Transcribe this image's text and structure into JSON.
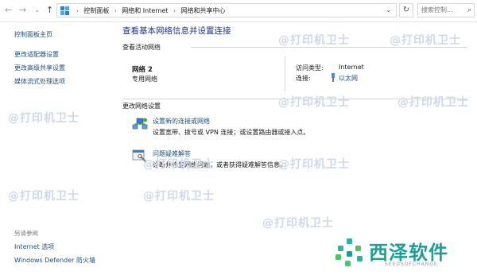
{
  "toolbar": {
    "back": "←",
    "forward": "→",
    "recent": "⌄",
    "up": "↑",
    "breadcrumbs": [
      "控制面板",
      "网络和 Internet",
      "网络和共享中心"
    ],
    "search_placeholder": "搜索控制..."
  },
  "sidebar": {
    "home": "控制面板主页",
    "links": [
      "更改适配器设置",
      "更改高级共享设置",
      "媒体流式处理选项"
    ],
    "see_also_title": "另请参阅",
    "see_also": [
      "Internet 选项",
      "Windows Defender 防火墙"
    ]
  },
  "main": {
    "title": "查看基本网络信息并设置连接",
    "active_networks_header": "查看活动网络",
    "network": {
      "name": "网络 2",
      "type": "专用网络",
      "access_type_label": "访问类型:",
      "access_type_value": "Internet",
      "connection_label": "连接:",
      "connection_value": "以太网"
    },
    "change_settings_header": "更改网络设置",
    "tasks": [
      {
        "link": "设置新的连接或网络",
        "desc": "设置宽带、拨号或 VPN 连接；或设置路由器或接入点。",
        "icon": "network-setup-icon"
      },
      {
        "link": "问题疑难解答",
        "desc": "诊断并修复网络问题，或者获得疑难解答信息。",
        "icon": "troubleshoot-icon"
      }
    ]
  },
  "watermarks": [
    "@打印机卫士",
    "@打印机卫士",
    "@打印机卫士",
    "@打印机卫士",
    "@打印机卫士",
    "@打印机卫士",
    "@打印机卫士",
    "@打印机卫士",
    "@打印机卫士",
    "@打印机卫士"
  ],
  "brand": {
    "name": "西泽软件",
    "subtitle": "SEEDSOFCHANGE"
  }
}
